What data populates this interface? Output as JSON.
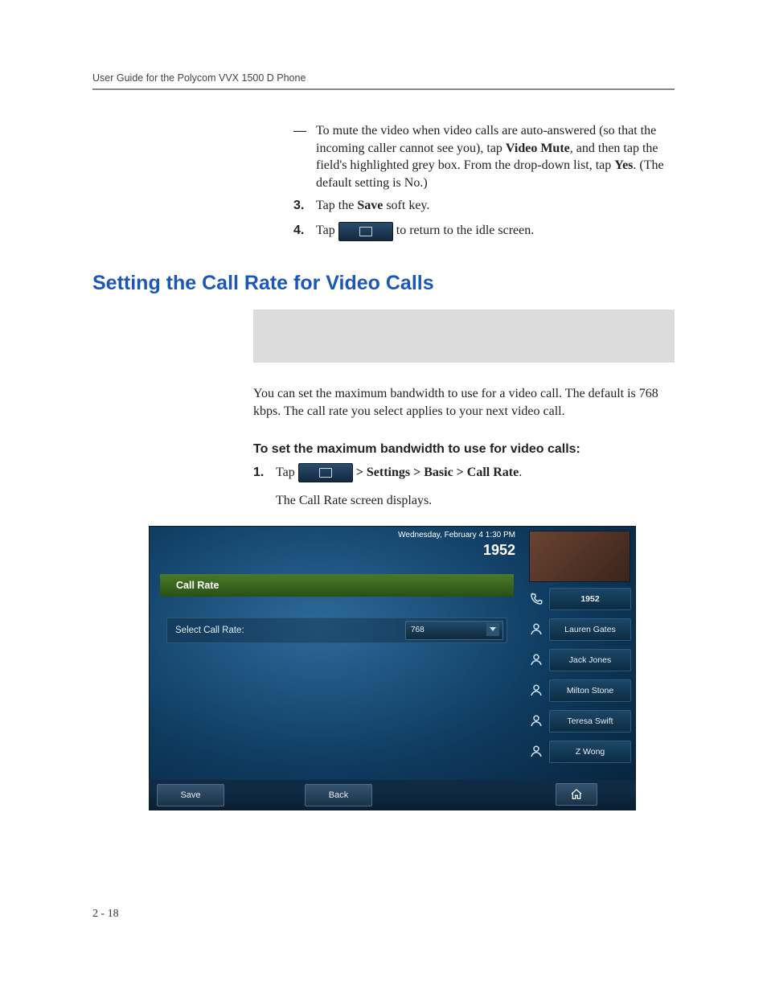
{
  "header": "User Guide for the Polycom VVX 1500 D Phone",
  "bullet_text_a": "To mute the video when video calls are auto-answered (so that the incoming caller cannot see you), tap ",
  "bullet_bold_a": "Video Mute",
  "bullet_text_b": ", and then tap the field's highlighted grey box. From the drop-down list, tap ",
  "bullet_bold_b": "Yes",
  "bullet_text_c": ". (The default setting is No.)",
  "step3_num": "3.",
  "step3_a": "Tap the ",
  "step3_bold": "Save",
  "step3_b": " soft key.",
  "step4_num": "4.",
  "step4_a": "Tap ",
  "step4_b": " to return to the idle screen.",
  "section_title": "Setting the Call Rate for Video Calls",
  "para1": "You can set the maximum bandwidth to use for a video call. The default is 768 kbps. The call rate you select applies to your next video call.",
  "subhead": "To set the maximum bandwidth to use for video calls:",
  "s1_num": "1.",
  "s1_a": "Tap ",
  "s1_b": " > Settings > Basic > Call Rate",
  "s1_c": ".",
  "s1_cont": "The Call Rate screen displays.",
  "phone": {
    "date": "Wednesday, February 4  1:30 PM",
    "ext": "1952",
    "title": "Call Rate",
    "row_label": "Select Call Rate:",
    "select_value": "768",
    "soft_save": "Save",
    "soft_back": "Back",
    "contacts": [
      "1952",
      "Lauren Gates",
      "Jack Jones",
      "Milton Stone",
      "Teresa Swift",
      "Z Wong"
    ]
  },
  "footer": "2 - 18"
}
